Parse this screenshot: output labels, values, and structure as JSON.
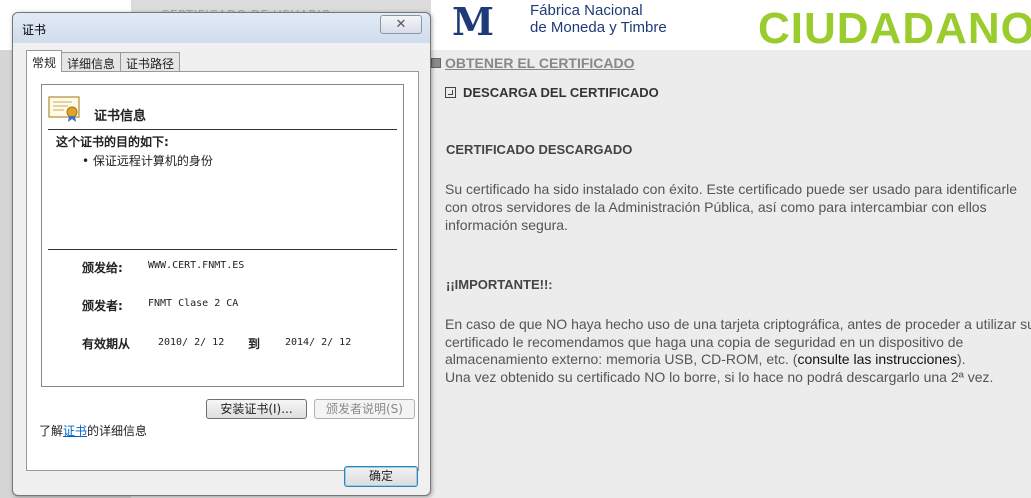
{
  "background_page": {
    "behind_tab_text": "CERTIFICADO DE USUARIO",
    "logo_letter": "M",
    "org_name_line1": "Fábrica Nacional",
    "org_name_line2": "de Moneda y Timbre",
    "brand_text": "CIUDADANO",
    "brand_color": "#9acc2d",
    "org_color": "#1f3a78",
    "obtener_link": "OBTENER EL CERTIFICADO",
    "descarga_label": "DESCARGA DEL CERTIFICADO",
    "section1_title": "CERTIFICADO DESCARGADO",
    "section1_text": "Su certificado ha sido instalado con éxito. Este certificado puede ser usado para identificarle con otros servidores de la Administración Pública, así como para intercambiar con ellos información segura.",
    "section2_title": "¡¡IMPORTANTE!!:",
    "section2_text_before": "En caso de que NO haya hecho uso de una tarjeta criptográfica, antes de proceder a utilizar su certificado le recomendamos que haga una copia de seguridad en un dispositivo de almacenamiento externo: memoria USB, CD-ROM, etc. (",
    "section2_link": "consulte las instrucciones",
    "section2_text_after": ").",
    "section2_text_last": "Una vez obtenido su certificado NO lo borre, si lo hace no podrá descargarlo una 2ª vez."
  },
  "dialog": {
    "title": "证书",
    "close_symbol": "✕",
    "tabs": [
      {
        "label": "常规",
        "active": true
      },
      {
        "label": "详细信息",
        "active": false
      },
      {
        "label": "证书路径",
        "active": false
      }
    ],
    "info_heading": "证书信息",
    "purpose_title": "这个证书的目的如下:",
    "purpose_item": "• 保证远程计算机的身份",
    "issued_to_label": "颁发给:",
    "issued_to_value": "WWW.CERT.FNMT.ES",
    "issued_by_label": "颁发者:",
    "issued_by_value": "FNMT Clase 2 CA",
    "validity_label": "有效期从",
    "valid_from": "2010/  2/  12",
    "to_word": "到",
    "valid_to": "2014/  2/  12",
    "install_button": "安装证书(I)...",
    "issuer_statement_button": "颁发者说明(S)",
    "learn_prefix": "了解",
    "learn_link": "证书",
    "learn_suffix": "的详细信息",
    "ok_button": "确定"
  }
}
